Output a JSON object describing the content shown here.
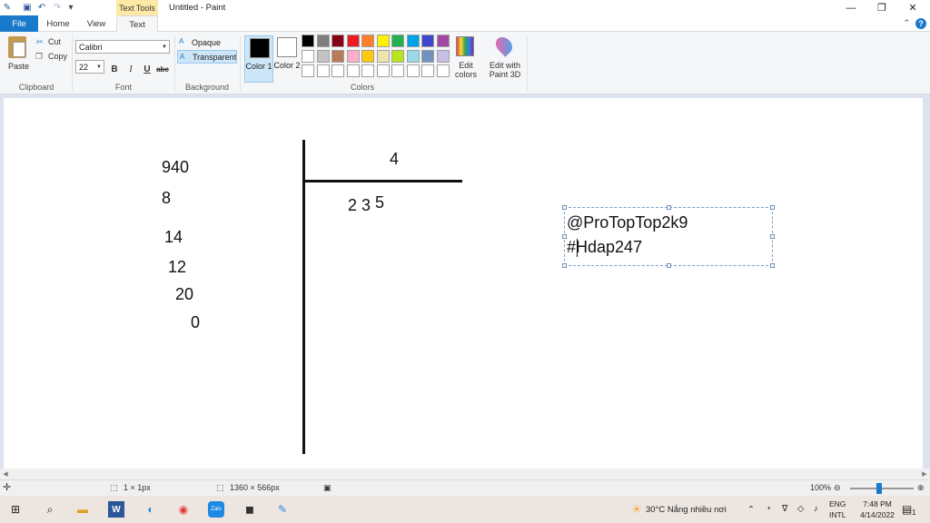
{
  "window": {
    "context_tab": "Text Tools",
    "title": "Untitled - Paint",
    "min": "—",
    "max": "❐",
    "close": "✕"
  },
  "tabs": [
    {
      "label": "File"
    },
    {
      "label": "Home"
    },
    {
      "label": "View"
    },
    {
      "label": "Text"
    }
  ],
  "ribbon": {
    "clipboard": {
      "paste": "Paste",
      "cut": "Cut",
      "copy": "Copy",
      "label": "Clipboard"
    },
    "font": {
      "family": "Calibri",
      "size": "22",
      "bold": "B",
      "italic": "I",
      "underline": "U",
      "strike": "abc",
      "label": "Font"
    },
    "background": {
      "opaque": "Opaque",
      "transparent": "Transparent",
      "label": "Background"
    },
    "colors": {
      "color1": "Color 1",
      "color2": "Color 2",
      "color1_value": "#000000",
      "color2_value": "#ffffff",
      "edit_colors": "Edit colors",
      "edit_3d": "Edit with Paint 3D",
      "label": "Colors",
      "palette_row1": [
        "#000000",
        "#7f7f7f",
        "#880015",
        "#ed1c24",
        "#ff7f27",
        "#fff200",
        "#22b14c",
        "#00a2e8",
        "#3f48cc",
        "#a349a4"
      ],
      "palette_row2": [
        "#ffffff",
        "#c3c3c3",
        "#b97a57",
        "#ffaec9",
        "#ffc90e",
        "#efe4b0",
        "#b5e61d",
        "#99d9ea",
        "#7092be",
        "#c8bfe7"
      ],
      "palette_row3": [
        "#ffffff",
        "#ffffff",
        "#ffffff",
        "#ffffff",
        "#ffffff",
        "#ffffff",
        "#ffffff",
        "#ffffff",
        "#ffffff",
        "#ffffff"
      ]
    }
  },
  "canvas": {
    "dividend": "940",
    "step1": "8",
    "step2": "14",
    "step3": "12",
    "step4": "20",
    "step5": "0",
    "divisor": "4",
    "quotient_a": "2 3",
    "quotient_b": "5",
    "textbox_line1": "@ProTopTop2k9",
    "textbox_line2": "#Hdap247"
  },
  "status": {
    "selection": "1 × 1px",
    "size": "1360 × 566px",
    "zoom": "100%"
  },
  "taskbar": {
    "weather": "30°C  Nắng nhiều nơi",
    "lang1": "ENG",
    "lang2": "INTL",
    "time": "7:48 PM",
    "date": "4/14/2022",
    "notif_count": "1"
  }
}
